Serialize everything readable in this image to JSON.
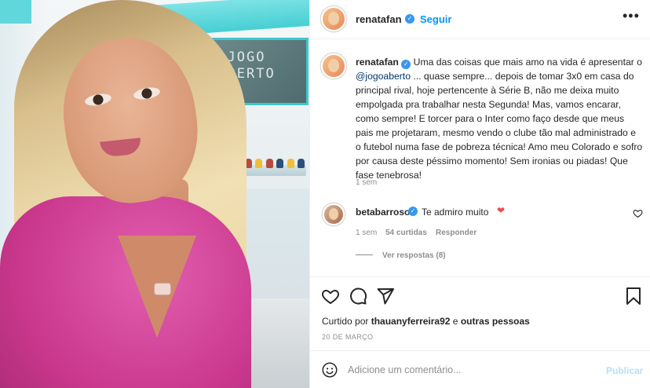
{
  "post": {
    "username": "renatafan",
    "follow_label": "Seguir",
    "separator": "•",
    "more_icon": "more-horizontal-icon",
    "caption": {
      "username": "renatafan",
      "text_part1": "Uma das coisas que mais amo na vida é apresentar o",
      "mention": "@jogoaberto",
      "text_part2": "... quase sempre... depois de tomar 3x0 em casa do principal rival, hoje pertencente à Série B, não me deixa muito empolgada pra trabalhar nesta Segunda! Mas, vamos encarar, como sempre! E torcer para o Inter como faço desde que meus pais me projetaram, mesmo vendo o clube tão mal administrado e o futebol numa fase de pobreza técnica! Amo meu Colorado e sofro por causa deste péssimo momento! Sem ironias ou piadas! Que fase tenebrosa!",
      "time": "1 sem"
    },
    "image": {
      "studio_logo": "JOGO ABERTO"
    }
  },
  "comment": {
    "username": "betabarroso",
    "text": "Te admiro muito",
    "heart": "❤",
    "time": "1 sem",
    "likes": "54 curtidas",
    "reply_label": "Responder",
    "view_replies": "Ver respostas (8)"
  },
  "actions": {
    "icons": [
      "heart-icon",
      "comment-icon",
      "share-icon",
      "bookmark-icon"
    ]
  },
  "likes_line": {
    "prefix": "Curtido por",
    "user": "thauanyferreira92",
    "middle": "e",
    "others": "outras pessoas"
  },
  "date": "20 DE MARÇO",
  "add_comment": {
    "placeholder": "Adicione um comentário...",
    "post_label": "Publicar"
  },
  "colors": {
    "link_blue": "#0095f6",
    "verified_blue": "#3897f0",
    "heart_red": "#ed4956",
    "disabled_blue": "#b2dffc"
  }
}
